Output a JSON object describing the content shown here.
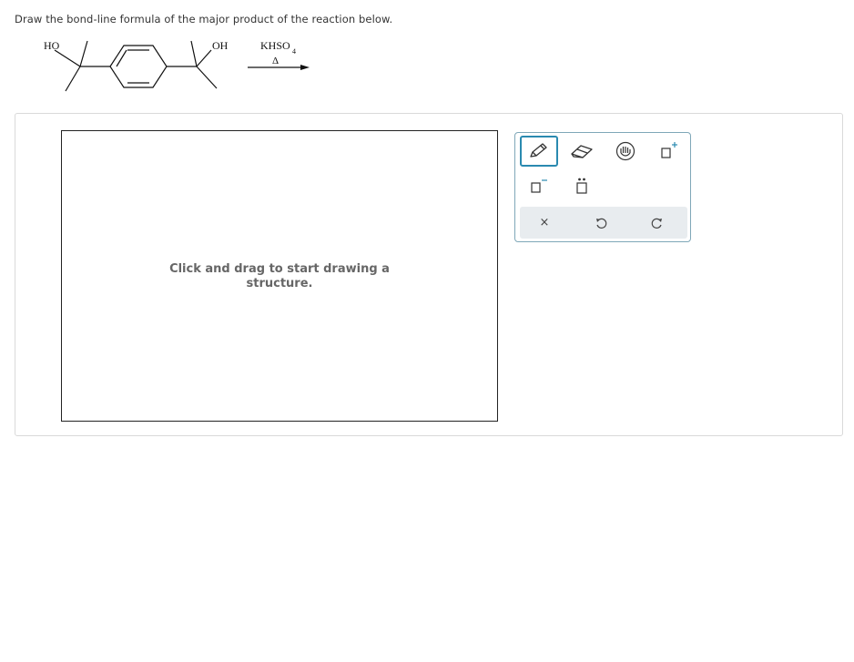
{
  "question": {
    "text": "Draw the bond-line formula of the major product of the reaction below."
  },
  "reaction": {
    "left_group": "HO",
    "right_group": "OH",
    "reagent": "KHSO",
    "reagent_subscript": "4",
    "condition": "Δ"
  },
  "canvas": {
    "hint_line1": "Click and drag to start drawing a",
    "hint_line2": "structure."
  },
  "toolbox": {
    "tools": [
      "pencil-tool",
      "eraser-tool",
      "hand-tool",
      "add-template-tool",
      "negative-charge-tool",
      "lone-pair-tool"
    ],
    "actions": [
      "clear",
      "undo",
      "redo"
    ],
    "clear_symbol": "×"
  },
  "colors": {
    "accent": "#2a8ab0",
    "toolbox_border": "#7fa7b8",
    "action_bar": "#e8ecef"
  }
}
